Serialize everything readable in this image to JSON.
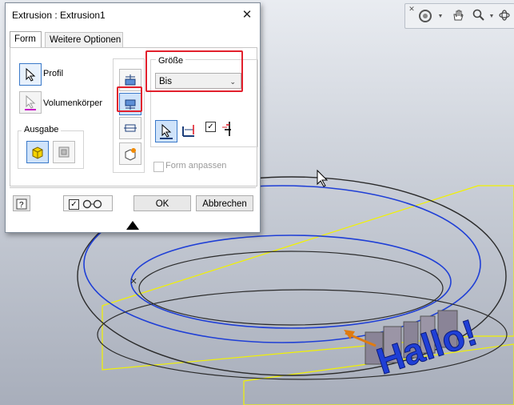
{
  "dialog": {
    "title": "Extrusion : Extrusion1",
    "tabs": [
      {
        "label": "Form",
        "active": true
      },
      {
        "label": "Weitere Optionen",
        "active": false
      }
    ],
    "profile_label": "Profil",
    "body_label": "Volumenkörper",
    "output_group_title": "Ausgabe",
    "size_group_title": "Größe",
    "extent_selected": "Bis",
    "match_shape_label": "Form anpassen",
    "ok_label": "OK",
    "cancel_label": "Abbrechen"
  },
  "viewport": {
    "text_3d": "Hallo!",
    "colors": {
      "profile_blue": "#1f3fd6",
      "edge_dark": "#2b2b2b",
      "plane_yellow": "#f2f200",
      "highlight_red": "#e2202c",
      "arrow_orange": "#e07b10"
    }
  },
  "navbar": {
    "icons": [
      "close-icon",
      "steering-wheel-icon",
      "pan-hand-icon",
      "zoom-icon",
      "orbit-icon"
    ]
  }
}
